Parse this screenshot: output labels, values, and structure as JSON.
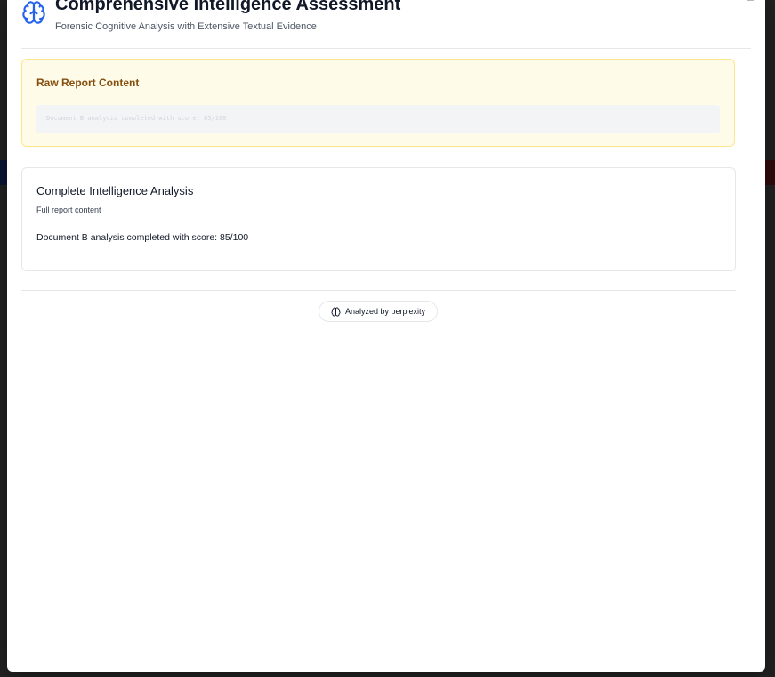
{
  "modal": {
    "title": "Comprehensive Intelligence Assessment",
    "subtitle": "Forensic Cognitive Analysis with Extensive Textual Evidence",
    "icon": "brain-icon",
    "accent_color": "#2563eb"
  },
  "raw_report": {
    "heading": "Raw Report Content",
    "content": "Document B analysis completed with score: 85/100"
  },
  "analysis": {
    "heading": "Complete Intelligence Analysis",
    "subheading": "Full report content",
    "body": "Document B analysis completed with score: 85/100"
  },
  "footer": {
    "badge_label": "Analyzed by perplexity",
    "badge_icon": "brain-icon"
  }
}
